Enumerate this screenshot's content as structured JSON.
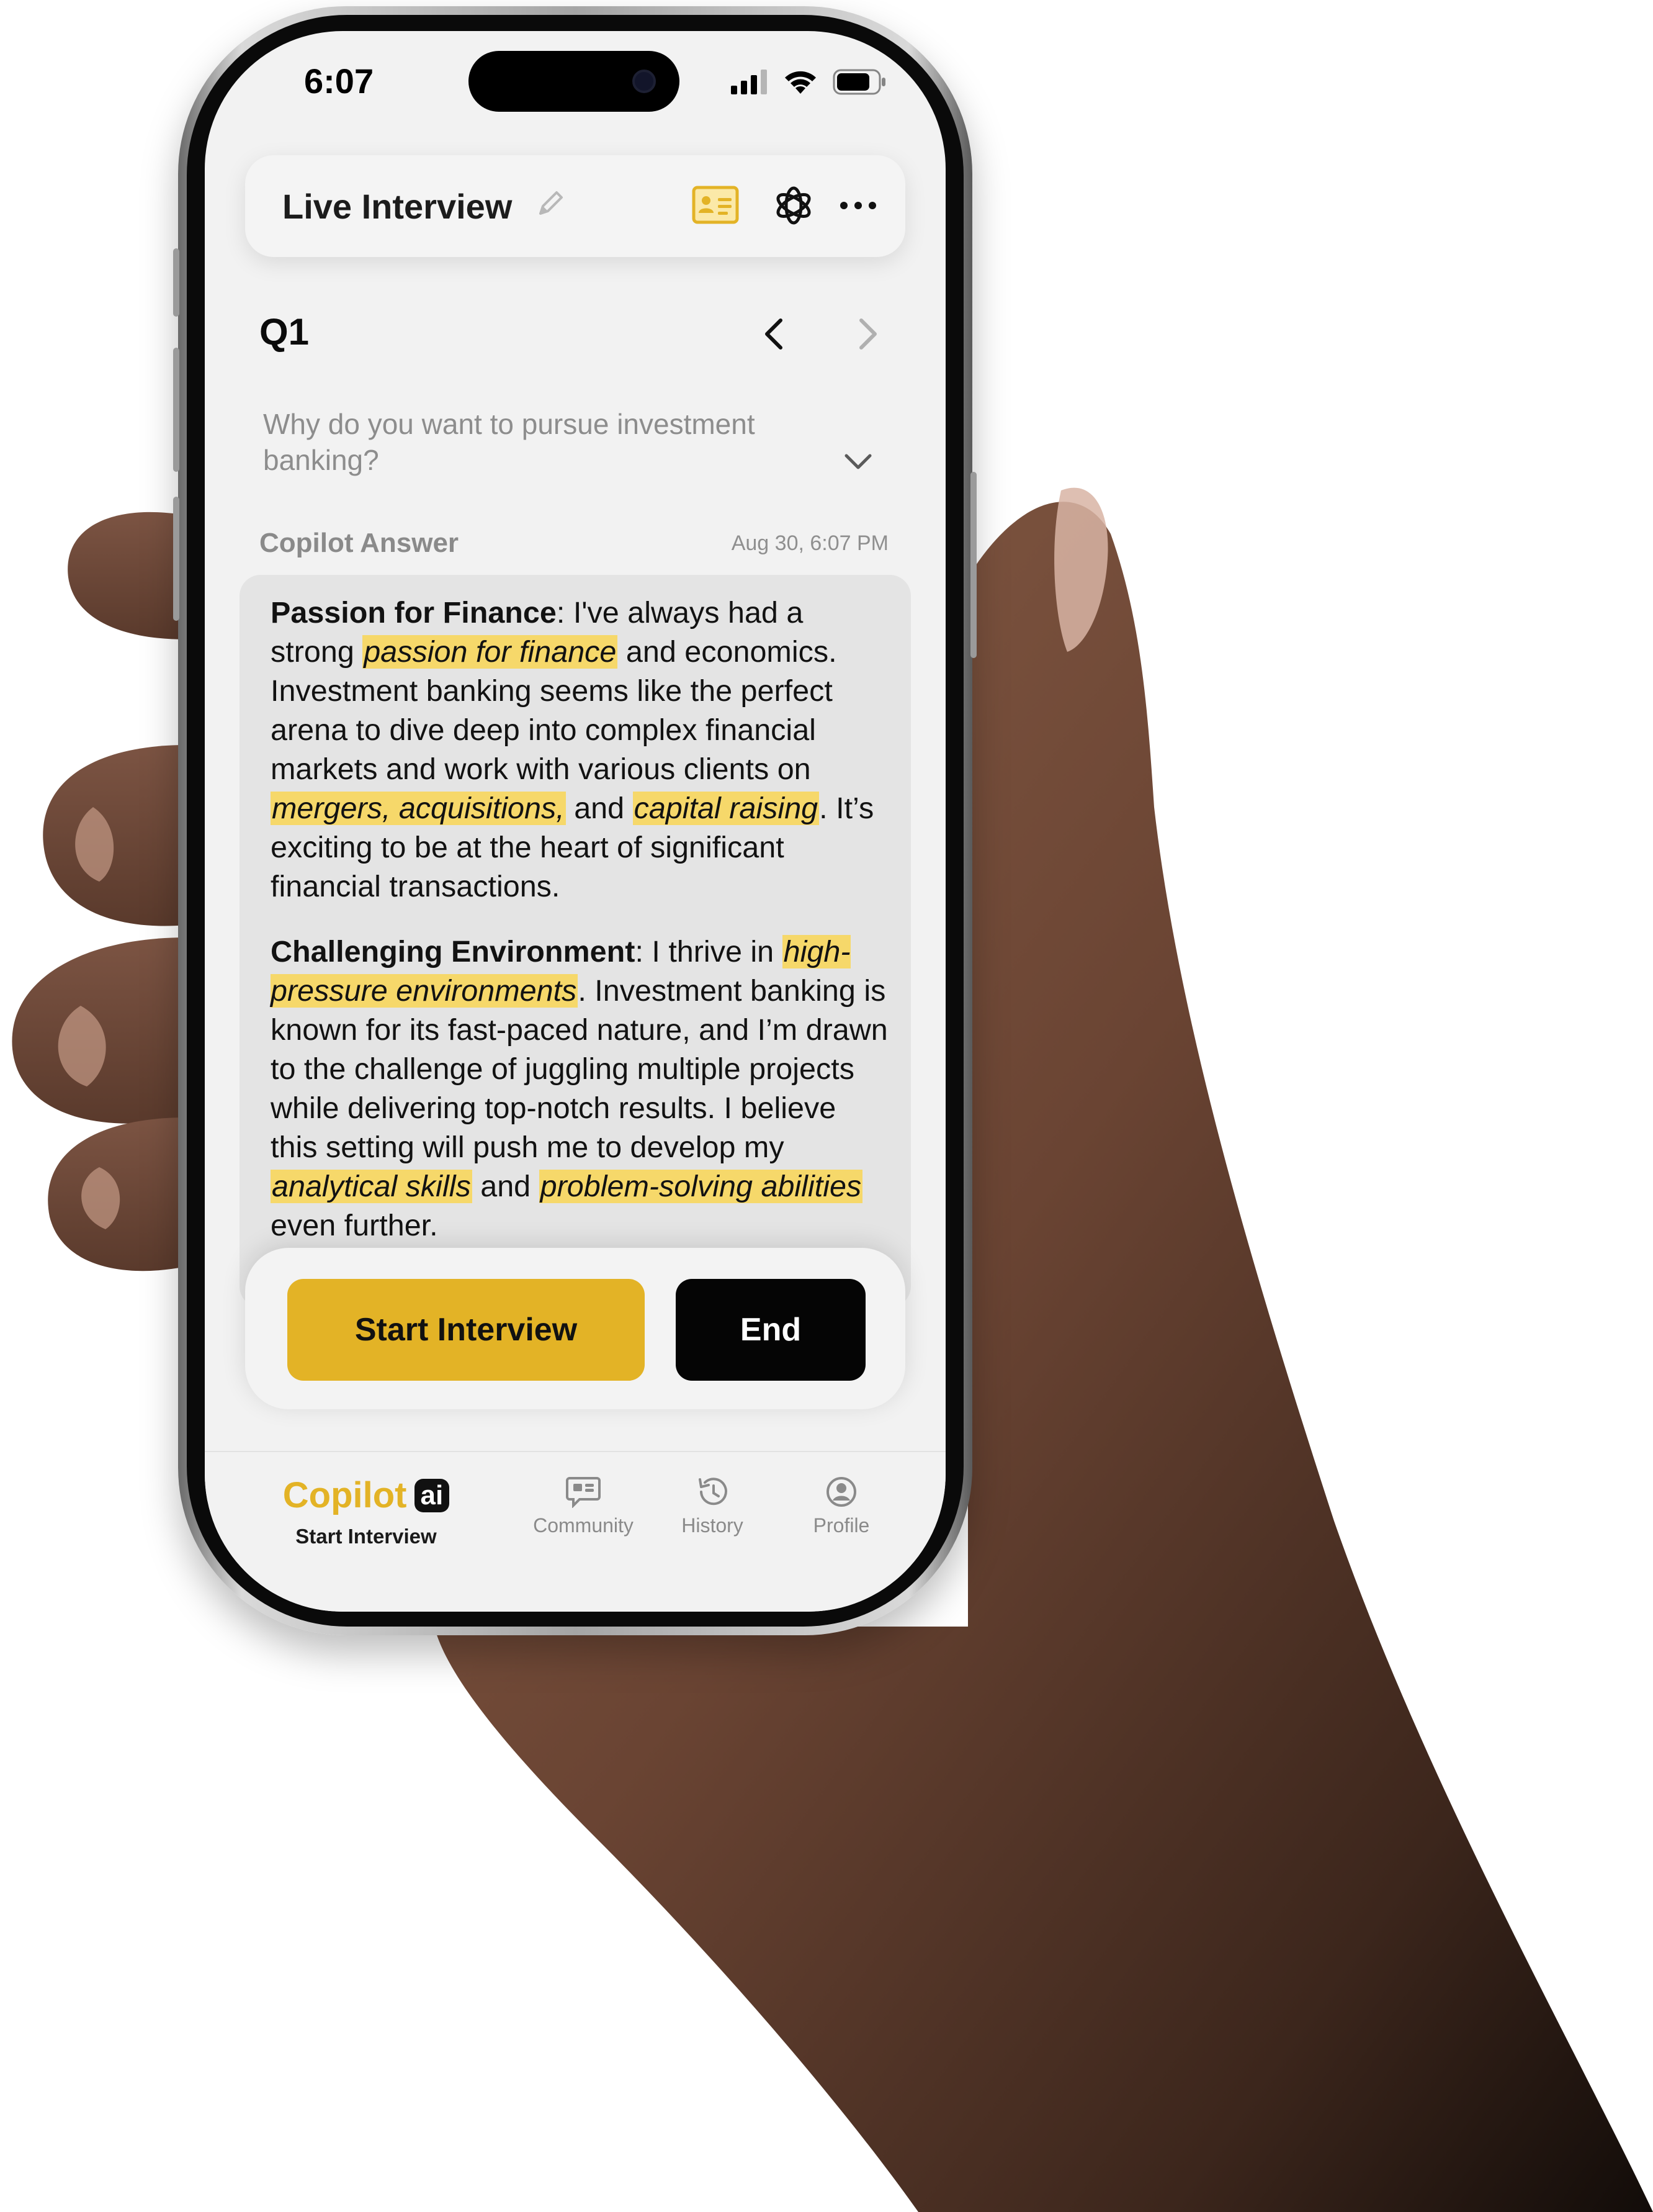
{
  "status_bar": {
    "time": "6:07"
  },
  "header": {
    "title": "Live Interview"
  },
  "question": {
    "number_label": "Q1",
    "text": "Why do you want to pursue investment banking?"
  },
  "answer": {
    "label": "Copilot Answer",
    "timestamp": "Aug 30, 6:07 PM",
    "paragraphs": [
      {
        "heading": "Passion for Finance",
        "t1": ": I've always had a strong ",
        "h1": "passion for finance",
        "t2": " and economics. Investment banking seems like the perfect arena to dive deep into complex financial markets and work with various clients on ",
        "h2": "mergers, acquisitions,",
        "t3": " and ",
        "h3": "capital raising",
        "t4": ". It’s exciting to be at the heart of significant financial transactions."
      },
      {
        "heading": "Challenging Environment",
        "t1": ": I thrive in ",
        "h1": "high-pressure environments",
        "t2": ". Investment banking is known for its fast-paced nature, and I’m drawn to the challenge of juggling multiple projects while delivering top-notch results. I believe this setting will push me to develop my ",
        "h2": "analytical skills",
        "t3": " and ",
        "h3": "problem-solving abilities",
        "t4": " even further."
      }
    ]
  },
  "actions": {
    "start_label": "Start Interview",
    "end_label": "End"
  },
  "tabbar": {
    "brand_word": "Copilot",
    "brand_badge": "ai",
    "brand_sub": "Start Interview",
    "items": [
      {
        "label": "Community",
        "icon": "community-icon"
      },
      {
        "label": "History",
        "icon": "history-icon"
      },
      {
        "label": "Profile",
        "icon": "profile-icon"
      }
    ]
  },
  "colors": {
    "accent": "#e3b326",
    "highlight": "#f6d86a",
    "end_button": "#050505",
    "screen_bg": "#f2f2f2"
  }
}
